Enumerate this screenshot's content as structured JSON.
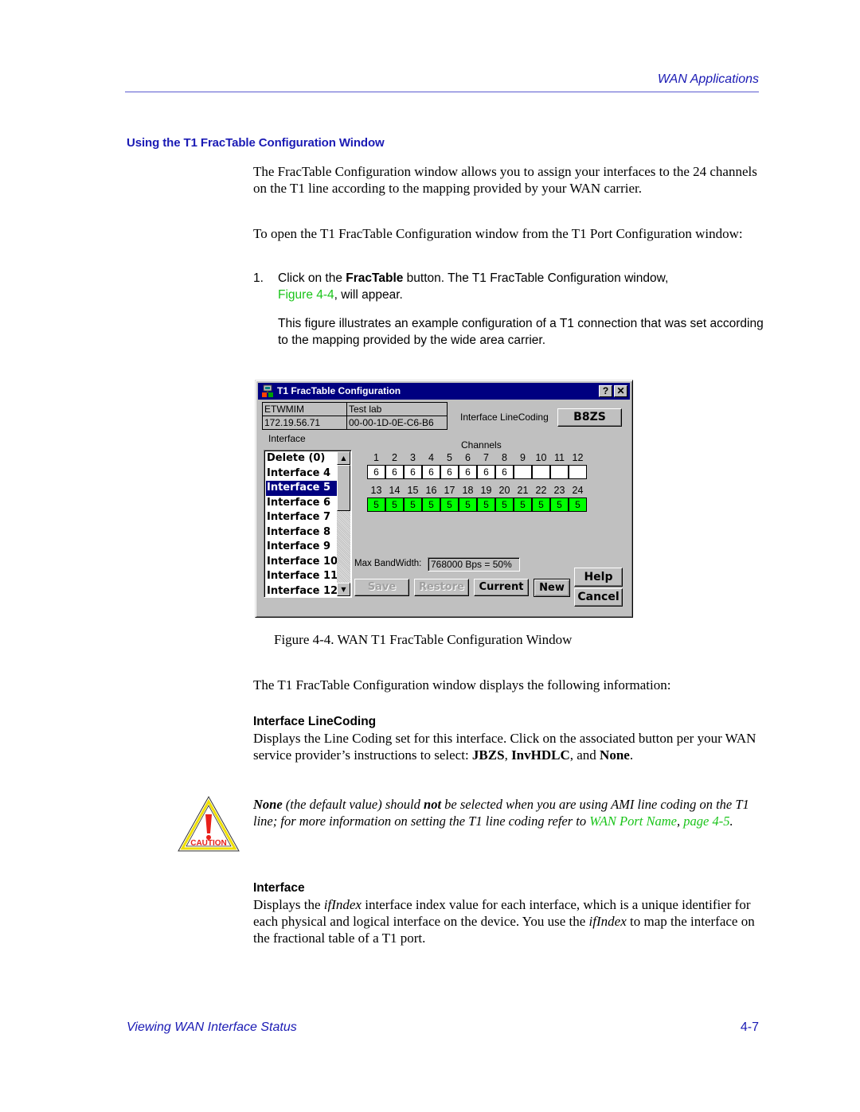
{
  "header": {
    "section_title": "WAN Applications"
  },
  "section": {
    "heading": "Using the T1 FracTable Configuration Window"
  },
  "intro": {
    "para1": "The FracTable Configuration window allows you to assign your interfaces to the 24 channels on the T1 line according to the mapping provided by your WAN carrier.",
    "para2": "To open the T1 FracTable Configuration window from the T1 Port Configuration window:"
  },
  "step1": {
    "number": "1.",
    "text_a": "Click on the ",
    "bold": "FracTable",
    "text_b": " button. The T1 FracTable Configuration window,",
    "link": "Figure 4-4",
    "text_c": ", will appear.",
    "note": "This figure illustrates an example configuration of a T1 connection that was set according to the mapping provided by the wide area carrier."
  },
  "window": {
    "title": "T1 FracTable Configuration",
    "help_btn": "?",
    "close_btn": "✕",
    "info": {
      "device_name": "ETWMIM",
      "location": "Test lab",
      "ip_address": "172.19.56.71",
      "mac_address": "00-00-1D-0E-C6-B6"
    },
    "linecoding_label": "Interface LineCoding",
    "linecoding_value": "B8ZS",
    "interface_label": "Interface",
    "channels_label": "Channels",
    "interfaces": [
      "Delete (0)",
      "Interface 4",
      "Interface 5",
      "Interface 6",
      "Interface 7",
      "Interface 8",
      "Interface 9",
      "Interface 10",
      "Interface 11",
      "Interface 12"
    ],
    "selected_interface": "Interface 5",
    "channel_numbers_row1": [
      "1",
      "2",
      "3",
      "4",
      "5",
      "6",
      "7",
      "8",
      "9",
      "10",
      "11",
      "12"
    ],
    "channel_values_row1": [
      "6",
      "6",
      "6",
      "6",
      "6",
      "6",
      "6",
      "6",
      "",
      "",
      "",
      ""
    ],
    "channel_numbers_row2": [
      "13",
      "14",
      "15",
      "16",
      "17",
      "18",
      "19",
      "20",
      "21",
      "22",
      "23",
      "24"
    ],
    "channel_values_row2": [
      "5",
      "5",
      "5",
      "5",
      "5",
      "5",
      "5",
      "5",
      "5",
      "5",
      "5",
      "5"
    ],
    "selected_color": "#00ff00",
    "bandwidth_label": "Max BandWidth:",
    "bandwidth_value": "768000 Bps = 50%",
    "buttons": {
      "save": "Save",
      "restore": "Restore",
      "current": "Current",
      "new": "New",
      "help": "Help",
      "cancel": "Cancel"
    },
    "scroll_up": "▲",
    "scroll_down": "▼"
  },
  "figure_caption": "Figure 4-4.  WAN T1 FracTable Configuration Window",
  "after_fig": "The T1 FracTable Configuration window displays the following information:",
  "linecoding_section": {
    "heading": "Interface LineCoding",
    "text_a": "Displays the Line Coding set for this interface. Click on the associated button per your WAN service provider’s instructions to select: ",
    "opt1": "JBZS",
    "sep1": ", ",
    "opt2": "InvHDLC",
    "sep2": ", and ",
    "opt3": "None",
    "end": "."
  },
  "caution": {
    "icon_label": "CAUTION",
    "bold1": "None",
    "text_a": " (the default value) should ",
    "bold2": "not",
    "text_b": " be selected when you are using AMI line coding on the T1 line; for more information on setting the T1 line coding refer to ",
    "link1": "WAN Port Name",
    "text_c": ", ",
    "link2": "page 4-5",
    "end": "."
  },
  "interface_section": {
    "heading": "Interface",
    "text_a": "Displays the ",
    "ital1": "ifIndex",
    "text_b": " interface index value for each interface, which is a unique identifier for each physical and logical interface on the device. You use the ",
    "ital2": "ifIndex",
    "text_c": " to map the interface on the fractional table of a T1 port."
  },
  "footer": {
    "chapter": "Viewing WAN Interface Status",
    "page": "4-7"
  }
}
